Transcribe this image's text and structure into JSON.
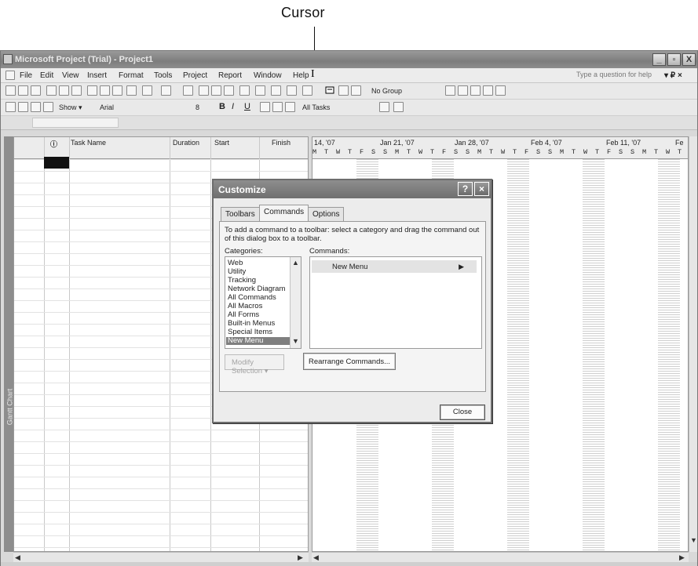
{
  "annotation": {
    "label": "Cursor"
  },
  "window": {
    "title": "Microsoft Project (Trial) - Project1",
    "caption_buttons": [
      "_",
      "▫",
      "X"
    ]
  },
  "menubar": {
    "items": [
      {
        "label": "File"
      },
      {
        "label": "Edit"
      },
      {
        "label": "View"
      },
      {
        "label": "Insert"
      },
      {
        "label": "Format"
      },
      {
        "label": "Tools"
      },
      {
        "label": "Project"
      },
      {
        "label": "Report"
      },
      {
        "label": "Window"
      },
      {
        "label": "Help"
      }
    ],
    "help_box": "Type a question for help",
    "doc_buttons": "▾ ₽ ×"
  },
  "toolbar1": {
    "group_dropdown": "No Group"
  },
  "toolbar2": {
    "show_label": "Show ▾",
    "font_dropdown": "Arial",
    "size_dropdown": "8",
    "filter_dropdown": "All Tasks",
    "bold": "B",
    "italic": "I",
    "underline": "U"
  },
  "table": {
    "columns": [
      "Task Name",
      "Duration",
      "Start",
      "Finish"
    ],
    "indicator_col_icon": "info-icon"
  },
  "view_bar": {
    "label": "Gantt Chart"
  },
  "gantt": {
    "weeks": [
      "14, '07",
      "Jan 21, '07",
      "Jan 28, '07",
      "Feb 4, '07",
      "Feb 11, '07",
      "Fe"
    ],
    "day_letters": "M T W T F S S M T W T F S S M T W T F S S M T W T F S S M T W T F S S"
  },
  "dialog": {
    "title": "Customize",
    "tabs": [
      "Toolbars",
      "Commands",
      "Options"
    ],
    "active_tab": "Commands",
    "instructions": "To add a command to a toolbar: select a category and drag the command out of this dialog box to a toolbar.",
    "categories_label": "Categories:",
    "commands_label": "Commands:",
    "categories": [
      "Web",
      "Utility",
      "Tracking",
      "Network Diagram",
      "All Commands",
      "All Macros",
      "All Forms",
      "Built-in Menus",
      "Special Items",
      "New Menu"
    ],
    "selected_category": "New Menu",
    "commands": [
      {
        "label": "New Menu"
      }
    ],
    "modify_label": "Modify Selection ▾",
    "rearrange_label": "Rearrange Commands...",
    "close_label": "Close"
  }
}
